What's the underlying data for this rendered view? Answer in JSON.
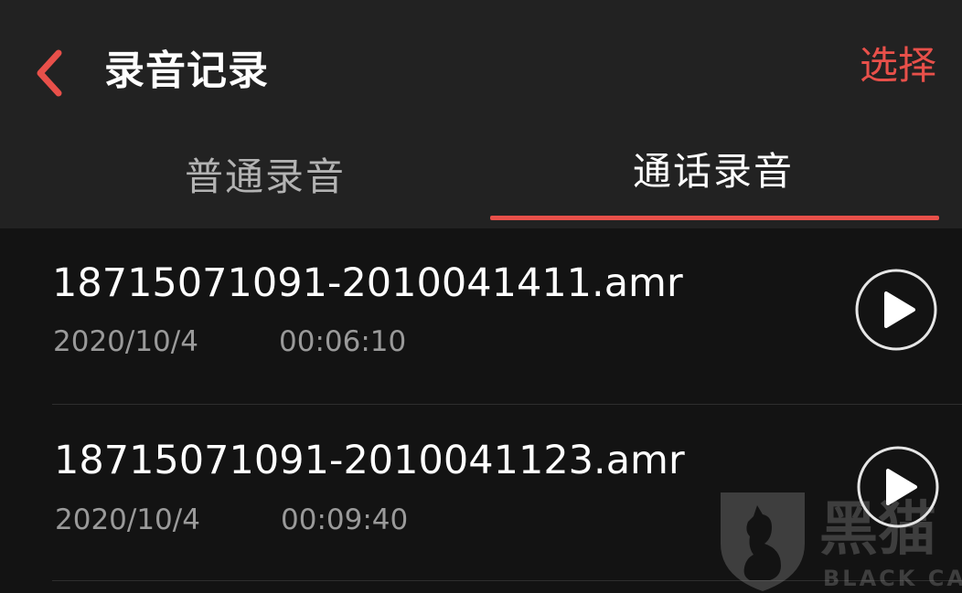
{
  "header": {
    "title": "录音记录",
    "select_label": "选择"
  },
  "tabs": [
    {
      "label": "普通录音",
      "active": false
    },
    {
      "label": "通话录音",
      "active": true
    }
  ],
  "recordings": [
    {
      "file_name": "18715071091-2010041411.amr",
      "date": "2020/10/4",
      "duration": "00:06:10"
    },
    {
      "file_name": "18715071091-2010041123.amr",
      "date": "2020/10/4",
      "duration": "00:09:40"
    }
  ],
  "watermark": {
    "text": "黑猫",
    "sub": "BLACK CAT"
  },
  "colors": {
    "accent": "#e8504a",
    "header_bg": "#222222",
    "list_bg": "#131313",
    "secondary_text": "#9a9a9a"
  },
  "icons": {
    "back": "chevron-left-icon",
    "play": "play-circle-icon",
    "watermark": "black-cat-logo"
  }
}
